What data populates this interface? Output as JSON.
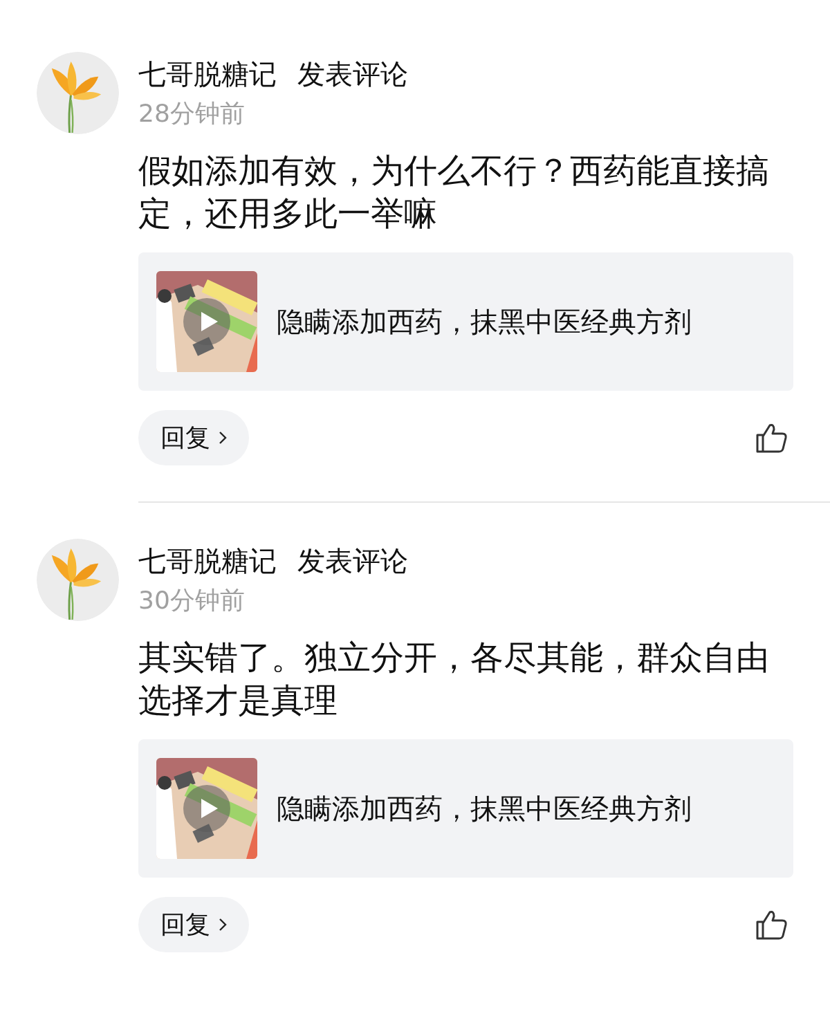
{
  "comments": [
    {
      "author": "七哥脱糖记",
      "action": "发表评论",
      "time": "28分钟前",
      "text": "假如添加有效，为什么不行？西药能直接搞定，还用多此一举嘛",
      "attachment": {
        "title": "隐瞒添加西药，抹黑中医经典方剂",
        "kind": "video"
      },
      "reply_label": "回复",
      "liked": false
    },
    {
      "author": "七哥脱糖记",
      "action": "发表评论",
      "time": "30分钟前",
      "text": "其实错了。独立分开，各尽其能，群众自由选择才是真理",
      "attachment": {
        "title": "隐瞒添加西药，抹黑中医经典方剂",
        "kind": "video"
      },
      "reply_label": "回复",
      "liked": false
    }
  ]
}
